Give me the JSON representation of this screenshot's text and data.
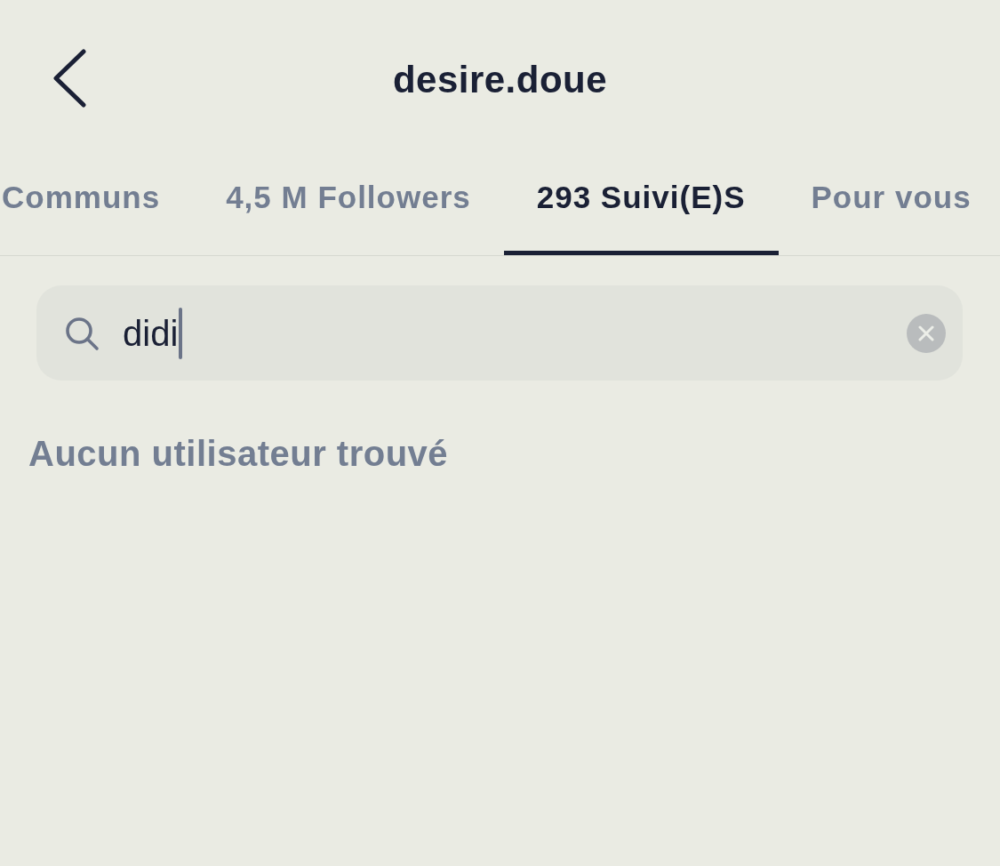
{
  "header": {
    "title": "desire.doue"
  },
  "tabs": [
    {
      "label": "Communs",
      "selected": false
    },
    {
      "label": "4,5 M Followers",
      "selected": false
    },
    {
      "label": "293 Suivi(E)S",
      "selected": true
    },
    {
      "label": "Pour vous",
      "selected": false
    }
  ],
  "search": {
    "value": "didi",
    "focused": true
  },
  "empty_message": "Aucun utilisateur trouvé"
}
